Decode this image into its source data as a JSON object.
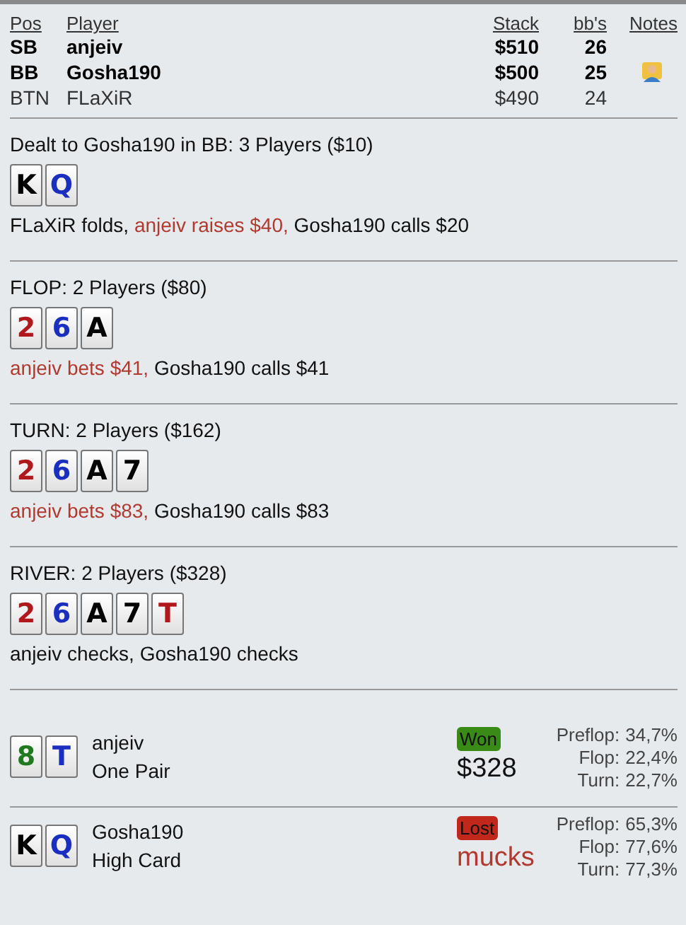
{
  "players": {
    "columns": [
      "Pos",
      "Player",
      "Stack",
      "bb's",
      "Notes"
    ],
    "rows": [
      {
        "pos": "SB",
        "name": "anjeiv",
        "stack": "$510",
        "bbs": "26",
        "active": true,
        "has_note": false
      },
      {
        "pos": "BB",
        "name": "Gosha190",
        "stack": "$500",
        "bbs": "25",
        "active": true,
        "has_note": true
      },
      {
        "pos": "BTN",
        "name": "FLaXiR",
        "stack": "$490",
        "bbs": "24",
        "active": false,
        "has_note": false
      }
    ]
  },
  "streets": [
    {
      "title": "Dealt to Gosha190 in BB: 3 Players ($10)",
      "cards": [
        {
          "rank": "K",
          "color": "#000000"
        },
        {
          "rank": "Q",
          "color": "#1a2ec0"
        }
      ],
      "actions": [
        {
          "text": "FLaXiR folds, ",
          "aggressive": false
        },
        {
          "text": "anjeiv raises $40, ",
          "aggressive": true
        },
        {
          "text": "Gosha190 calls $20",
          "aggressive": false
        }
      ]
    },
    {
      "title": "FLOP: 2 Players ($80)",
      "cards": [
        {
          "rank": "2",
          "color": "#b0181c"
        },
        {
          "rank": "6",
          "color": "#1a2ec0"
        },
        {
          "rank": "A",
          "color": "#000000"
        }
      ],
      "actions": [
        {
          "text": "anjeiv bets $41, ",
          "aggressive": true
        },
        {
          "text": "Gosha190 calls $41",
          "aggressive": false
        }
      ]
    },
    {
      "title": "TURN: 2 Players ($162)",
      "cards": [
        {
          "rank": "2",
          "color": "#b0181c"
        },
        {
          "rank": "6",
          "color": "#1a2ec0"
        },
        {
          "rank": "A",
          "color": "#000000"
        },
        {
          "rank": "7",
          "color": "#000000"
        }
      ],
      "actions": [
        {
          "text": "anjeiv bets $83, ",
          "aggressive": true
        },
        {
          "text": "Gosha190 calls $83",
          "aggressive": false
        }
      ]
    },
    {
      "title": "RIVER: 2 Players ($328)",
      "cards": [
        {
          "rank": "2",
          "color": "#b0181c"
        },
        {
          "rank": "6",
          "color": "#1a2ec0"
        },
        {
          "rank": "A",
          "color": "#000000"
        },
        {
          "rank": "7",
          "color": "#000000"
        },
        {
          "rank": "T",
          "color": "#b0181c"
        }
      ],
      "actions": [
        {
          "text": "anjeiv checks, Gosha190 checks",
          "aggressive": false
        }
      ]
    }
  ],
  "results": [
    {
      "cards": [
        {
          "rank": "8",
          "color": "#1f7a1f"
        },
        {
          "rank": "T",
          "color": "#1a2ec0"
        }
      ],
      "name": "anjeiv",
      "hand": "One Pair",
      "outcome": {
        "kind": "won",
        "label": "Won"
      },
      "amount": "$328",
      "equity": [
        {
          "street": "Preflop:",
          "value": "34,7%"
        },
        {
          "street": "Flop:",
          "value": "22,4%"
        },
        {
          "street": "Turn:",
          "value": "22,7%"
        }
      ]
    },
    {
      "cards": [
        {
          "rank": "K",
          "color": "#000000"
        },
        {
          "rank": "Q",
          "color": "#1a2ec0"
        }
      ],
      "name": "Gosha190",
      "hand": "High Card",
      "outcome": {
        "kind": "lost",
        "label": "Lost"
      },
      "amount": "mucks",
      "equity": [
        {
          "street": "Preflop:",
          "value": "65,3%"
        },
        {
          "street": "Flop:",
          "value": "77,6%"
        },
        {
          "street": "Turn:",
          "value": "77,3%"
        }
      ]
    }
  ]
}
